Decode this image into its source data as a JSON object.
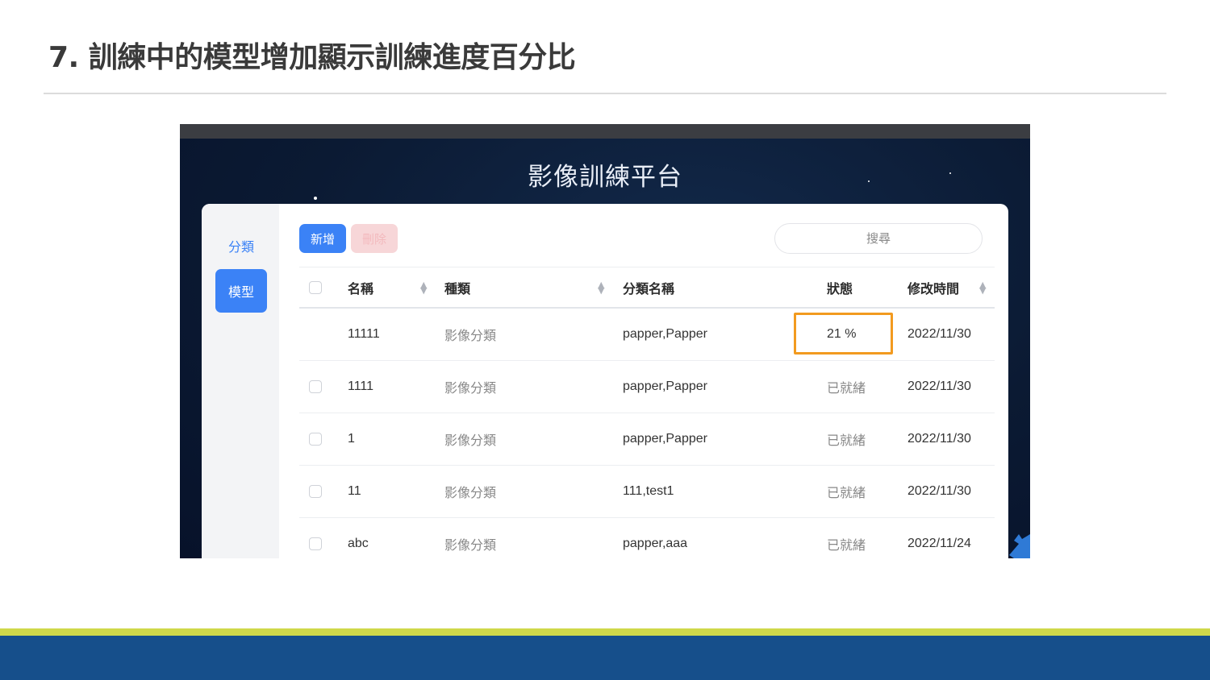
{
  "slide": {
    "title": "7. 訓練中的模型增加顯示訓練進度百分比"
  },
  "app": {
    "title": "影像訓練平台",
    "sidebar": {
      "items": [
        {
          "label": "分類"
        },
        {
          "label": "模型"
        }
      ]
    },
    "toolbar": {
      "add_label": "新增",
      "delete_label": "刪除"
    },
    "search": {
      "placeholder": "搜尋"
    },
    "table": {
      "headers": {
        "name": "名稱",
        "type": "種類",
        "category": "分類名稱",
        "status": "狀態",
        "modified": "修改時間"
      },
      "rows": [
        {
          "name": "11111",
          "type": "影像分類",
          "category": "papper,Papper",
          "status": "21 %",
          "modified": "2022/11/30"
        },
        {
          "name": "1111",
          "type": "影像分類",
          "category": "papper,Papper",
          "status": "已就緒",
          "modified": "2022/11/30"
        },
        {
          "name": "1",
          "type": "影像分類",
          "category": "papper,Papper",
          "status": "已就緒",
          "modified": "2022/11/30"
        },
        {
          "name": "11",
          "type": "影像分類",
          "category": "111,test1",
          "status": "已就緒",
          "modified": "2022/11/30"
        },
        {
          "name": "abc",
          "type": "影像分類",
          "category": "papper,aaa",
          "status": "已就緒",
          "modified": "2022/11/24"
        }
      ]
    }
  },
  "colors": {
    "accent": "#3b82f6",
    "highlight": "#f29a1f",
    "band_yellow": "#cfd84a",
    "band_blue": "#164f8b"
  }
}
